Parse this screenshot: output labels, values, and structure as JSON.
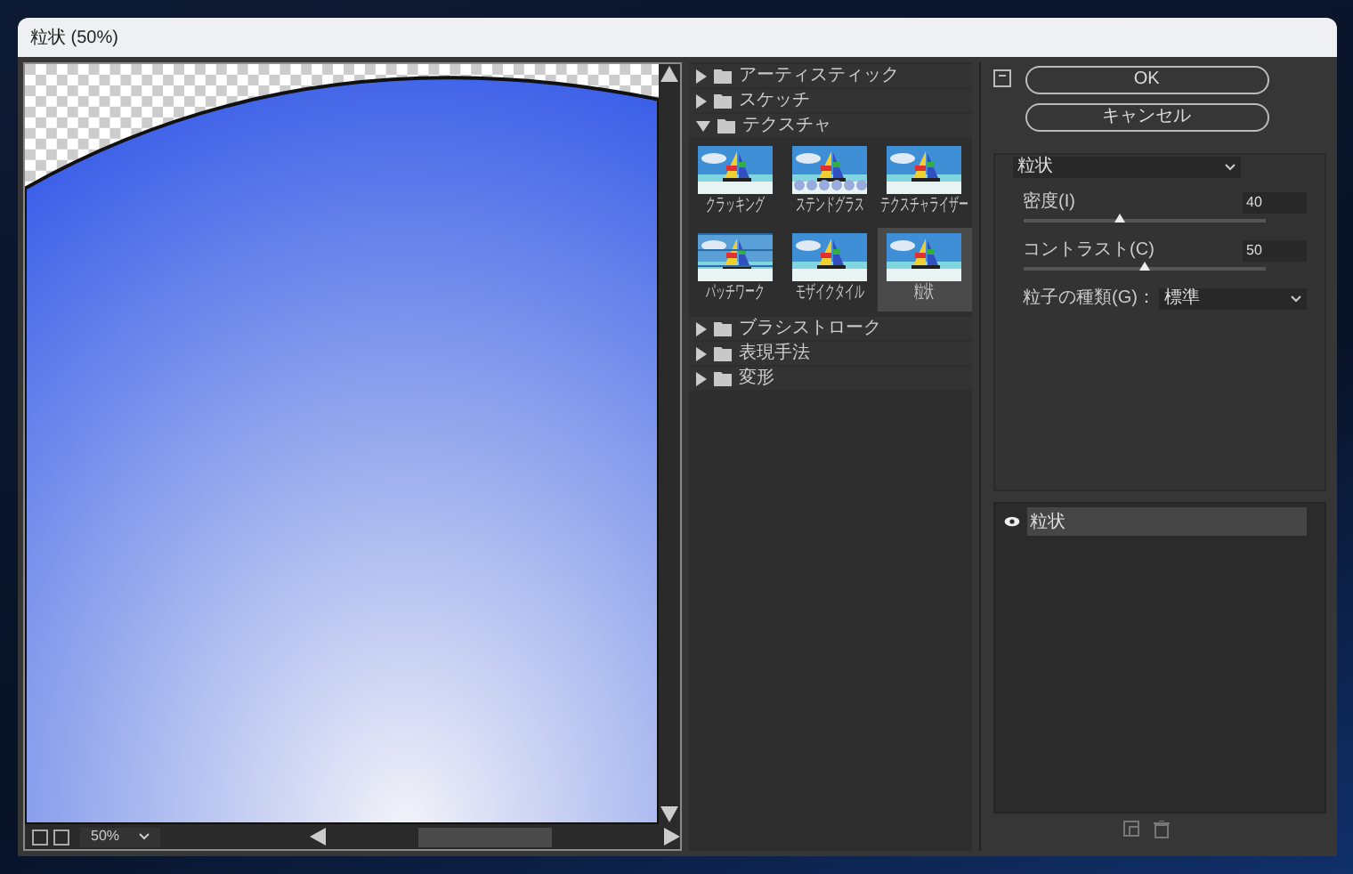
{
  "window": {
    "title": "粒状 (50%)"
  },
  "preview": {
    "zoom": "50%"
  },
  "filter_tree": [
    {
      "label": "アーティスティック",
      "expanded": false
    },
    {
      "label": "スケッチ",
      "expanded": false
    },
    {
      "label": "テクスチャ",
      "expanded": true,
      "children": [
        {
          "label": "クラッキング",
          "selected": false
        },
        {
          "label": "ステンドグラス",
          "selected": false
        },
        {
          "label": "テクスチャライザー",
          "selected": false
        },
        {
          "label": "パッチワーク",
          "selected": false
        },
        {
          "label": "モザイクタイル",
          "selected": false
        },
        {
          "label": "粒状",
          "selected": true
        }
      ]
    },
    {
      "label": "ブラシストローク",
      "expanded": false
    },
    {
      "label": "表現手法",
      "expanded": false
    },
    {
      "label": "変形",
      "expanded": false
    }
  ],
  "buttons": [
    "OK",
    "キャンセル"
  ],
  "filter_select": {
    "value": "粒状"
  },
  "settings": [
    {
      "kind": "slider",
      "label": "密度(I)",
      "value": "40",
      "level": 0.4
    },
    {
      "kind": "slider",
      "label": "コントラスト(C)",
      "value": "50",
      "level": 0.5
    },
    {
      "kind": "select",
      "label": "粒子の種類(G)：",
      "value": "標準"
    }
  ],
  "layers": [
    {
      "label": "粒状",
      "visible": true,
      "selected": true
    }
  ]
}
